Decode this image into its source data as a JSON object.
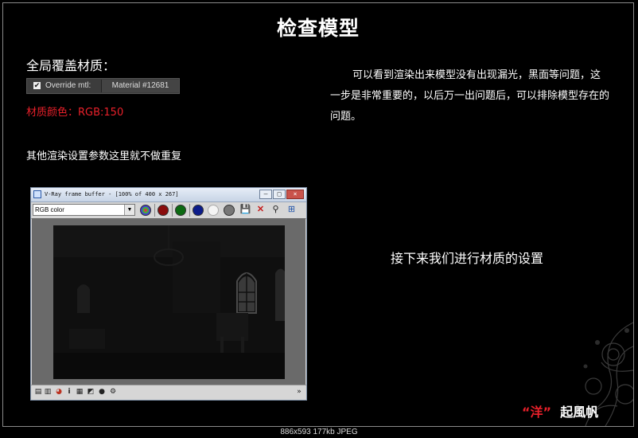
{
  "slide": {
    "title": "检查模型",
    "global_override_heading": "全局覆盖材质：",
    "override_bar": {
      "checkbox_label": "Override mtl:",
      "material_button": "Material #12681",
      "checked": true
    },
    "material_color_text": "材质颜色：RGB:150",
    "other_settings_text": "其他渲染设置参数这里就不做重复",
    "paragraph": "可以看到渲染出来模型没有出现漏光，黑面等问题，这一步是非常重要的，以后万一出问题后，可以排除模型存在的问题。",
    "next_step_text": "接下来我们进行材质的设置",
    "signature": {
      "open_quote": "“",
      "name_a": "洋",
      "close_quote": "”",
      "name_b": "起風帆"
    },
    "accent_color": "#e8202a"
  },
  "vray_window": {
    "title": "V-Ray frame buffer - [100% of 400 x 267]",
    "channel_select": "RGB color",
    "toolbar_icons": [
      "rgb-channel-icon",
      "red-channel-icon",
      "green-channel-icon",
      "blue-channel-icon",
      "alpha-channel-icon",
      "mono-channel-icon",
      "save-icon",
      "clear-icon",
      "pick-icon",
      "region-render-icon"
    ],
    "status_icons": [
      "history-icon",
      "compare-icon",
      "color-correct-icon",
      "info-icon",
      "lens-effects-icon",
      "level-icon",
      "stamp-icon",
      "options-icon"
    ]
  },
  "image_info": "886x593 177kb JPEG"
}
